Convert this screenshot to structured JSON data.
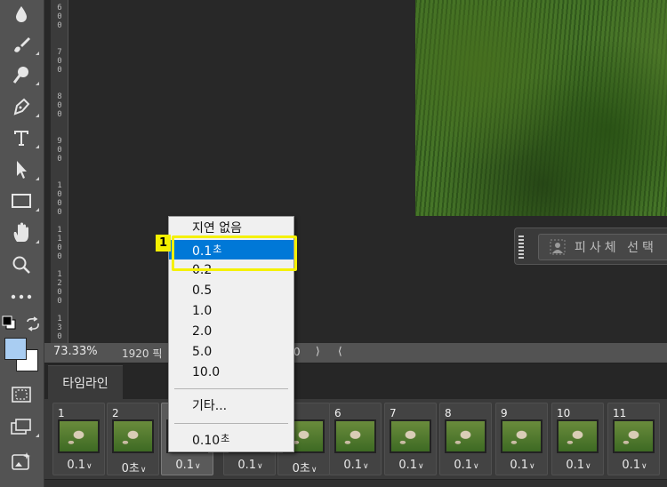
{
  "ruler_labels": [
    "6\n0\n0",
    "7\n0\n0",
    "8\n0\n0",
    "9\n0\n0",
    "1\n0\n0\n0",
    "1\n1\n0\n0",
    "1\n2\n0\n0",
    "1\n3\n0"
  ],
  "subject_select": {
    "label": "피사체 선택"
  },
  "status": {
    "zoom": "73.33%",
    "doc_info": "1920 픽",
    "partial_value": "0",
    "arrow_right": "⟩",
    "arrow_left": "⟨"
  },
  "timeline": {
    "tab_label": "타임라인",
    "frames": [
      {
        "num": "1",
        "delay": "0.1",
        "selected": false
      },
      {
        "num": "2",
        "delay": "0초",
        "selected": false
      },
      {
        "num": "",
        "delay": "0.1",
        "selected": true
      },
      {
        "num": "",
        "delay": "0.1",
        "selected": false
      },
      {
        "num": "",
        "delay": "0초",
        "selected": false
      },
      {
        "num": "6",
        "delay": "0.1",
        "selected": false
      },
      {
        "num": "7",
        "delay": "0.1",
        "selected": false
      },
      {
        "num": "8",
        "delay": "0.1",
        "selected": false
      },
      {
        "num": "9",
        "delay": "0.1",
        "selected": false
      },
      {
        "num": "10",
        "delay": "0.1",
        "selected": false
      },
      {
        "num": "11",
        "delay": "0.1",
        "selected": false
      }
    ]
  },
  "delay_menu": {
    "items": [
      {
        "label": "지연 없음",
        "suffix": ""
      },
      {
        "label": "0.1",
        "suffix": "초",
        "highlighted": true
      },
      {
        "label": "0.2",
        "suffix": ""
      },
      {
        "label": "0.5",
        "suffix": ""
      },
      {
        "label": "1.0",
        "suffix": ""
      },
      {
        "label": "2.0",
        "suffix": ""
      },
      {
        "label": "5.0",
        "suffix": ""
      },
      {
        "label": "10.0",
        "suffix": ""
      },
      {
        "label": "기타...",
        "suffix": ""
      },
      {
        "label": "0.10",
        "suffix": "초"
      }
    ]
  },
  "annotation": {
    "badge": "1",
    "color": "#f5f100"
  },
  "colors": {
    "highlight": "#0078d7",
    "foreground_swatch": "#a9cdf2",
    "background_swatch": "#ffffff"
  },
  "icons": [
    "drop-icon",
    "brush-icon",
    "dodge-icon",
    "pen-icon",
    "type-icon",
    "selection-arrow-icon",
    "rectangle-icon",
    "hand-icon",
    "zoom-icon",
    "more-icon",
    "swap-colors-icon",
    "quick-mask-icon",
    "screen-mode-icon",
    "generative-icon"
  ]
}
